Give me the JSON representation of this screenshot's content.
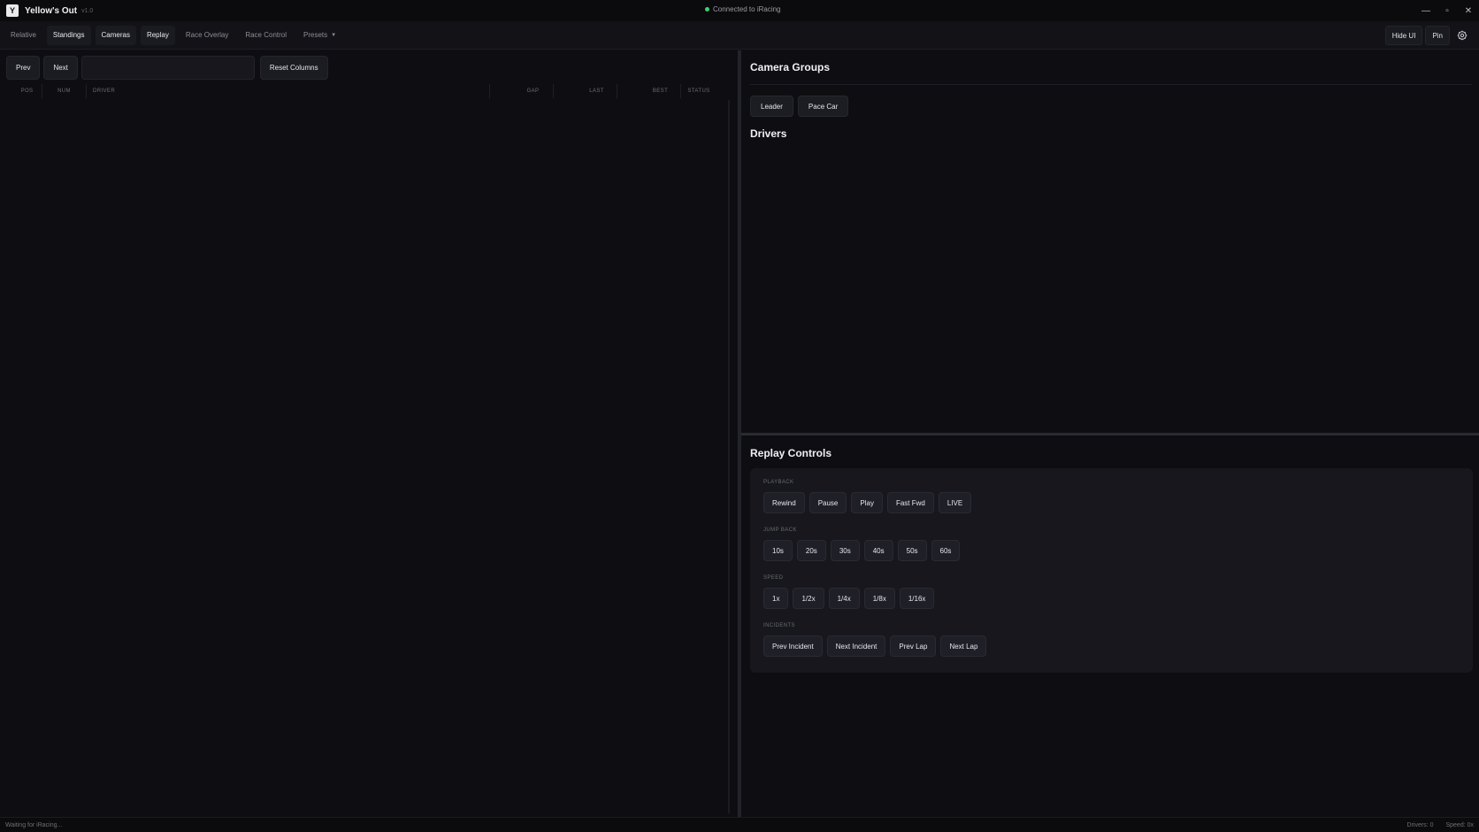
{
  "titlebar": {
    "title": "Yellow's Out",
    "version": "v1.0",
    "connection": "Connected to iRacing",
    "minimize": "—",
    "maximize": "▫",
    "close": "✕"
  },
  "nav": {
    "tabs": [
      {
        "label": "Relative",
        "active": false
      },
      {
        "label": "Standings",
        "active": true
      },
      {
        "label": "Cameras",
        "active": true
      },
      {
        "label": "Replay",
        "active": true
      },
      {
        "label": "Race Overlay",
        "active": false
      },
      {
        "label": "Race Control",
        "active": false
      },
      {
        "label": "Presets",
        "active": false
      }
    ],
    "hide_ui": "Hide UI",
    "pin": "Pin"
  },
  "standings": {
    "prev": "Prev",
    "next": "Next",
    "search_value": "",
    "reset_columns": "Reset Columns",
    "columns": [
      "POS",
      "NUM",
      "DRIVER",
      "GAP",
      "LAST",
      "BEST",
      "STATUS"
    ]
  },
  "cameras": {
    "title": "Camera Groups",
    "groups": [
      "Leader",
      "Pace Car"
    ],
    "drivers_title": "Drivers"
  },
  "replay": {
    "title": "Replay Controls",
    "playback_label": "PLAYBACK",
    "playback": [
      "Rewind",
      "Pause",
      "Play",
      "Fast Fwd",
      "LIVE"
    ],
    "jump_label": "JUMP BACK",
    "jump": [
      "10s",
      "20s",
      "30s",
      "40s",
      "50s",
      "60s"
    ],
    "speed_label": "SPEED",
    "speed": [
      "1x",
      "1/2x",
      "1/4x",
      "1/8x",
      "1/16x"
    ],
    "incidents_label": "INCIDENTS",
    "incidents": [
      "Prev Incident",
      "Next Incident",
      "Prev Lap",
      "Next Lap"
    ]
  },
  "status": {
    "left": "Waiting for iRacing...",
    "drivers": "Drivers: 0",
    "speed": "Speed: 0x"
  },
  "colors": {
    "background": "#0e0e12",
    "connected": "#3fd16a"
  }
}
